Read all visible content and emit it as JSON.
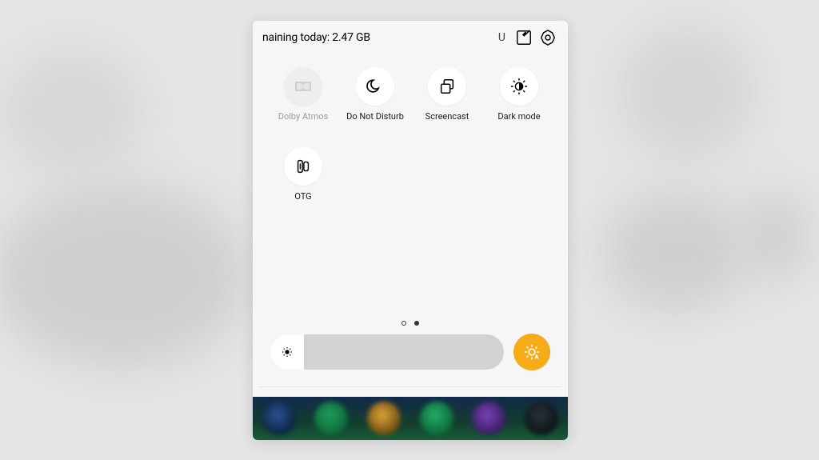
{
  "top": {
    "data_text": "naining today: 2.47 GB",
    "u": "U"
  },
  "toggles": {
    "t1": {
      "label": "Dolby Atmos"
    },
    "t2": {
      "label": "Do Not Disturb"
    },
    "t3": {
      "label": "Screencast"
    },
    "t4": {
      "label": "Dark mode"
    },
    "t5": {
      "label": "OTG"
    }
  },
  "icons": {
    "edit": "edit-icon",
    "settings": "settings-gear-icon",
    "dolby": "dolby-icon",
    "dnd": "moon-crescent-icon",
    "screencast": "screencast-icon",
    "dark": "brightness-half-icon",
    "otg": "otg-connector-icon",
    "brightness_low": "brightness-low-icon",
    "auto_brightness": "auto-brightness-icon",
    "notif_games": "game-controller-icon"
  },
  "colors": {
    "auto_brightness": "#f6ab19",
    "notif_icon": "#1a73e8"
  },
  "pager": {
    "count": 2,
    "active": 1
  },
  "brightness": {
    "value": 0
  }
}
